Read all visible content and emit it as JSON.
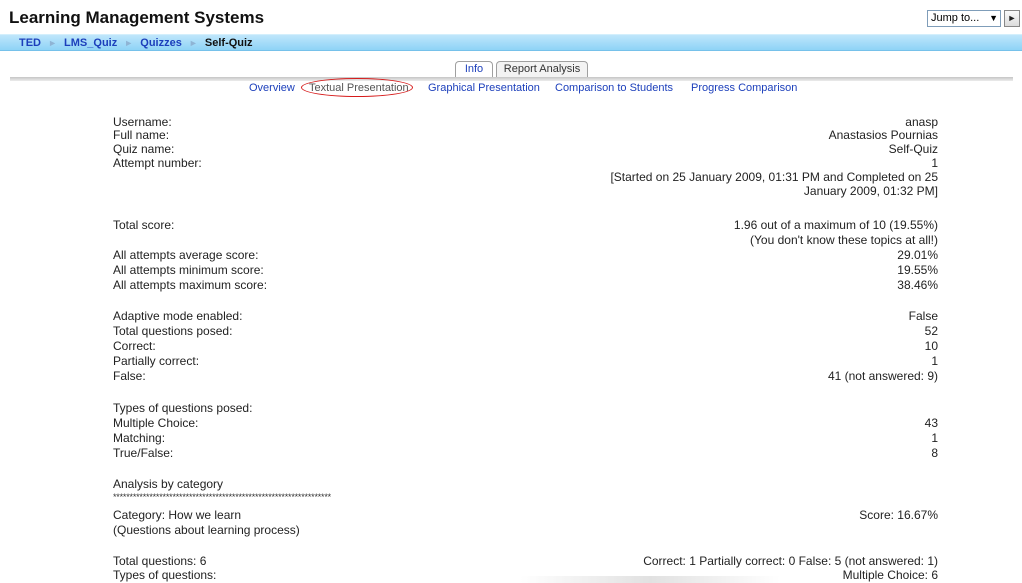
{
  "header": {
    "site_title": "Learning Management Systems",
    "jump_label": "Jump to...",
    "jump_arrow": "▼",
    "go_label": "►"
  },
  "breadcrumb": [
    "TED",
    "LMS_Quiz",
    "Quizzes",
    "Self-Quiz"
  ],
  "breadcrumb_sep": "►",
  "tabs": {
    "info": "Info",
    "report": "Report Analysis"
  },
  "subtabs": {
    "overview": "Overview",
    "textual": "Textual Presentation",
    "graphical": "Graphical Presentation",
    "comparison": "Comparison to Students",
    "progress": "Progress Comparison"
  },
  "report": {
    "username_label": "Username:",
    "username": "anasp",
    "fullname_label": "Full name:",
    "fullname": "Anastasios Pournias",
    "quiz_label": "Quiz name:",
    "quiz": "Self-Quiz",
    "attempt_label": "Attempt number:",
    "attempt": "1",
    "started_line1": "[Started on 25 January 2009, 01:31 PM and Completed on 25",
    "started_line2": "January 2009, 01:32 PM]",
    "total_label": "Total score:",
    "total": "1.96 out of a maximum of 10 (19.55%)",
    "total_note": "(You don't know these topics at all!)",
    "avg_label": "All attempts average score:",
    "avg": "29.01%",
    "min_label": "All attempts minimum score:",
    "min": "19.55%",
    "max_label": "All attempts maximum score:",
    "max": "38.46%",
    "adaptive_label": "Adaptive mode enabled:",
    "adaptive": "False",
    "posed_label": "Total questions posed:",
    "posed": "52",
    "correct_label": "Correct:",
    "correct": "10",
    "partial_label": "Partially correct:",
    "partial": "1",
    "false_label": "False:",
    "false": "41 (not answered: 9)",
    "types_label": "Types of questions posed:",
    "mc_label": "Multiple Choice:",
    "mc": "43",
    "matching_label": "Matching:",
    "matching": "1",
    "tf_label": "True/False:",
    "tf": "8",
    "analysis_label": "Analysis by category",
    "stars": "******************************************************************",
    "category_label": "Category: How we learn",
    "category_score": "Score: 16.67%",
    "category_desc": "(Questions about learning process)",
    "cat_total_label": "Total questions: 6",
    "cat_total": "Correct: 1 Partially correct: 0 False: 5 (not answered: 1)",
    "cat_types_label": "Types of questions:",
    "cat_types": "Multiple Choice: 6"
  }
}
